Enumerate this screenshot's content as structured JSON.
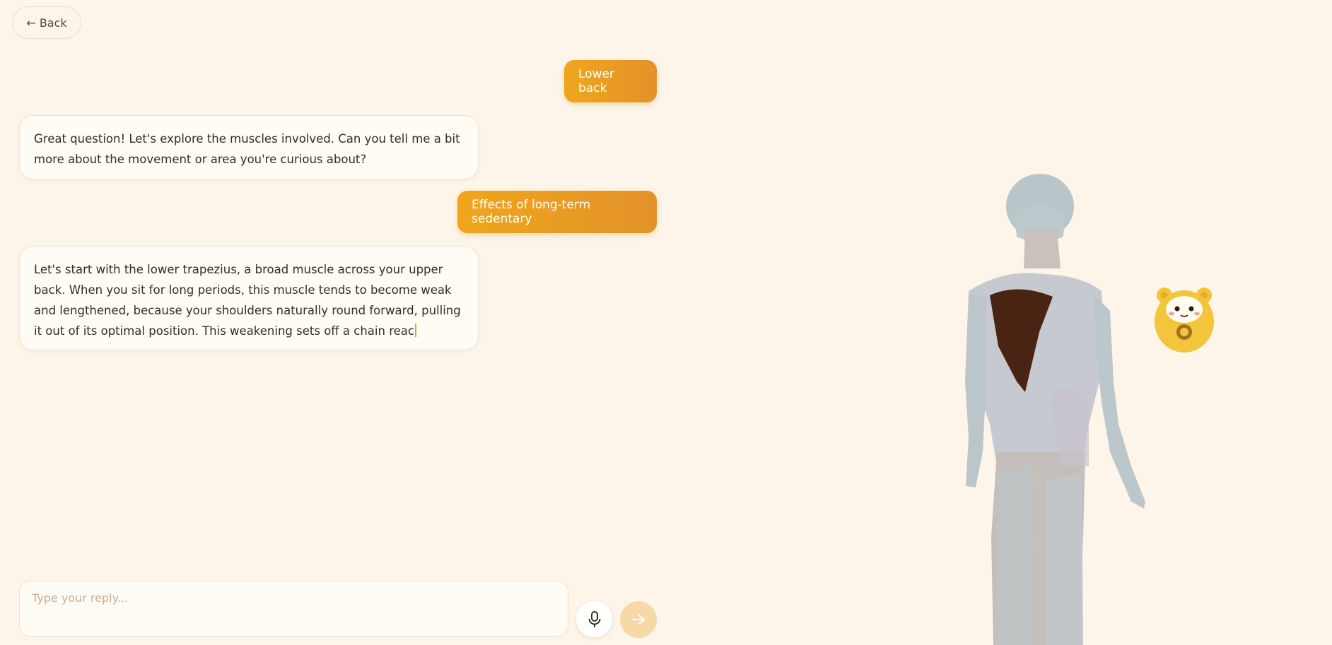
{
  "nav": {
    "back_label": "← Back"
  },
  "messages": [
    {
      "role": "user",
      "text": "Lower back"
    },
    {
      "role": "assistant",
      "text": "Great question! Let's explore the muscles involved. Can you tell me a bit more about the movement or area you're curious about?"
    },
    {
      "role": "user",
      "text": "Effects of long-term sedentary"
    },
    {
      "role": "assistant",
      "text": "Let's start with the lower trapezius, a broad muscle across your upper back. When you sit for long periods, this muscle tends to become weak and lengthened, because your shoulders naturally round forward, pulling it out of its optimal position. This weakening sets off a chain reac"
    }
  ],
  "composer": {
    "placeholder": "Type your reply...",
    "value": ""
  },
  "icons": {
    "mic": "microphone-icon",
    "send": "arrow-right-icon",
    "mascot": "bear-mascot"
  },
  "colors": {
    "background": "#fdf5e9",
    "accent": "#eba024",
    "highlighted_muscle": "#4a2412",
    "body_model": "#b9c5c9"
  }
}
